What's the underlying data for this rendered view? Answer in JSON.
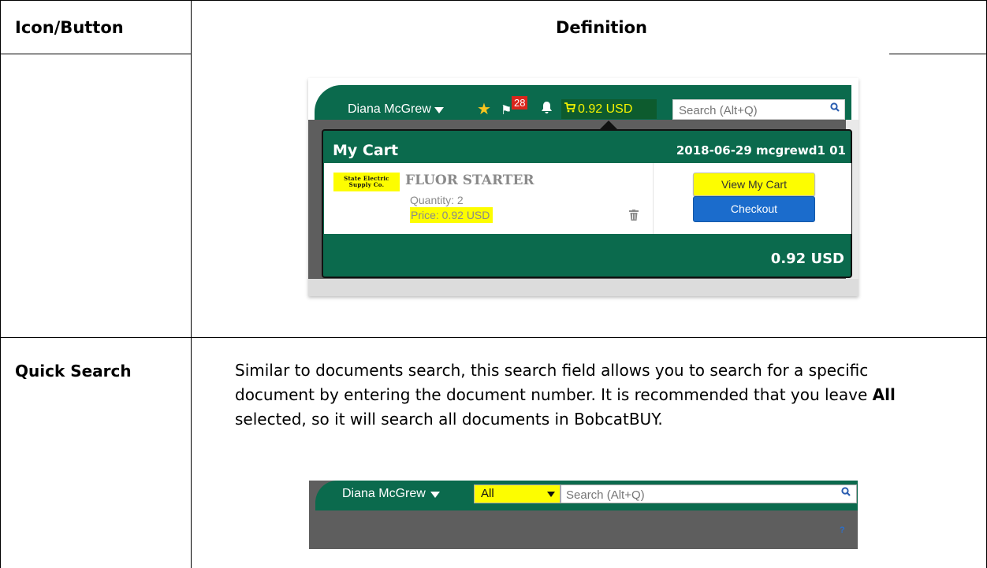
{
  "table": {
    "headers": [
      "Icon/Button",
      "Definition"
    ]
  },
  "row1": {
    "toolbar": {
      "user_name": "Diana McGrew",
      "badge_count": "28",
      "cart_total": "0.92 USD",
      "search_placeholder": "Search (Alt+Q)"
    },
    "cart": {
      "title": "My Cart",
      "cart_name": "2018-06-29 mcgrewd1 01",
      "supplier_logo": "State Electric Supply Co.",
      "product_name": "FLUOR STARTER",
      "quantity": "Quantity: 2",
      "price": "Price: 0.92 USD",
      "view_button": "View My Cart",
      "checkout_button": "Checkout",
      "total": "0.92 USD"
    }
  },
  "row2": {
    "label": "Quick Search",
    "desc_part1": "Similar to documents search, this search field allows you to search for a specific document by entering the document number. It is recommended that you leave ",
    "desc_bold": "All",
    "desc_part2": " selected, so it will search all documents in BobcatBUY.",
    "toolbar": {
      "user_name": "Diana McGrew",
      "scope_value": "All",
      "search_placeholder": "Search (Alt+Q)",
      "help": "?"
    }
  },
  "colors": {
    "toolbar_green": "#0b6a4d",
    "highlight_yellow": "#fdfd00",
    "checkout_blue": "#1b6ccc"
  }
}
